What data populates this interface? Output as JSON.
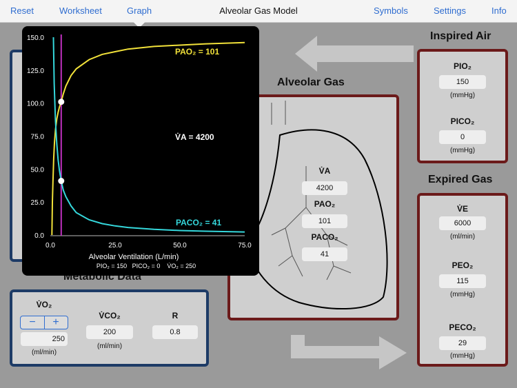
{
  "nav": {
    "reset": "Reset",
    "worksheet": "Worksheet",
    "graph": "Graph",
    "title": "Alveolar Gas Model",
    "symbols": "Symbols",
    "settings": "Settings",
    "info": "Info"
  },
  "inspired": {
    "title": "Inspired Air",
    "pio2_label": "PIO₂",
    "pio2_value": "150",
    "pio2_unit": "(mmHg)",
    "pico2_label": "PICO₂",
    "pico2_value": "0",
    "pico2_unit": "(mmHg)"
  },
  "alveolar": {
    "title": "Alveolar Gas",
    "va_label": "V̇A",
    "va_value": "4200",
    "pao2_label": "PAO₂",
    "pao2_value": "101",
    "paco2_label": "PACO₂",
    "paco2_value": "41"
  },
  "expired": {
    "title": "Expired Gas",
    "ve_label": "V̇E",
    "ve_value": "6000",
    "ve_unit": "(ml/min)",
    "peo2_label": "PEO₂",
    "peo2_value": "115",
    "peo2_unit": "(mmHg)",
    "peco2_label": "PECO₂",
    "peco2_value": "29",
    "peco2_unit": "(mmHg)"
  },
  "metabolic": {
    "title": "Metabolic Data",
    "vo2_label": "V̇O₂",
    "vo2_value": "250",
    "vo2_unit": "(ml/min)",
    "stepper_minus": "−",
    "stepper_plus": "+",
    "vco2_label": "V̇CO₂",
    "vco2_value": "200",
    "vco2_unit": "(ml/min)",
    "r_label": "R",
    "r_value": "0.8"
  },
  "graph": {
    "pao2_annotation": "PAO₂ = 101",
    "paco2_annotation": "PACO₂ = 41",
    "va_annotation": "V̇A = 4200",
    "footer": "PIO₂ = 150   PICO₂ = 0    V̇O₂ = 250"
  },
  "chart_data": {
    "type": "line",
    "title": "",
    "xlabel": "Alveolar Ventilation (L/min)",
    "ylabel": "",
    "xlim": [
      0,
      75
    ],
    "ylim": [
      0,
      150
    ],
    "x_ticks": [
      "0.0",
      "25.0",
      "50.0",
      "75.0"
    ],
    "y_ticks": [
      "0.0",
      "25.0",
      "50.0",
      "75.0",
      "100.0",
      "125.0",
      "150.0"
    ],
    "marker_x": 4.2,
    "series": [
      {
        "name": "PAO₂",
        "color": "#f2e23a",
        "x": [
          0.6,
          0.8,
          1.0,
          1.3,
          1.6,
          2.0,
          2.5,
          3.0,
          3.5,
          4.2,
          5,
          6,
          8,
          10,
          15,
          20,
          25,
          30,
          40,
          50,
          60,
          75
        ],
        "y": [
          0,
          25,
          40,
          58,
          70,
          80,
          88,
          93,
          97,
          101,
          107,
          113,
          121,
          126,
          133,
          137,
          139,
          141,
          143,
          144,
          145,
          146
        ]
      },
      {
        "name": "PACO₂",
        "color": "#35d8dc",
        "x": [
          1.2,
          1.5,
          2.0,
          2.5,
          3.0,
          3.5,
          4.2,
          5,
          6,
          8,
          10,
          15,
          20,
          25,
          30,
          40,
          50,
          60,
          75
        ],
        "y": [
          150,
          115,
          86,
          69,
          57,
          49,
          41,
          34,
          29,
          22,
          17,
          11.5,
          8.6,
          6.9,
          5.7,
          4.3,
          3.4,
          2.9,
          2.3
        ]
      }
    ],
    "points": [
      {
        "x": 4.2,
        "y": 101
      },
      {
        "x": 4.2,
        "y": 41
      }
    ]
  }
}
